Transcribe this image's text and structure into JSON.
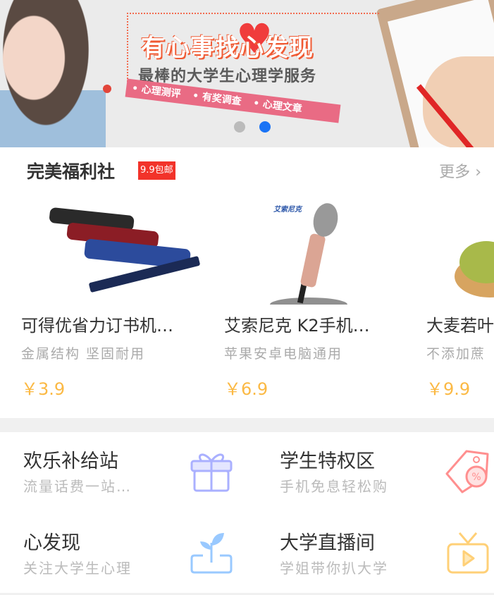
{
  "banner": {
    "headline": "有心事找心发现",
    "subtitle": "最棒的大学生心理学服务",
    "tags": [
      "• 心理测评",
      "• 有奖调查",
      "• 心理文章"
    ],
    "slides_total": 2,
    "active_slide": 2,
    "dot_colors": {
      "inactive": "#bbbbbb",
      "active": "#1a73f5"
    }
  },
  "welfare": {
    "title": "完美福利社",
    "badge": "9.9包邮",
    "more": "更多",
    "products": [
      {
        "title": "可得优省力订书机…",
        "subtitle": "金属结构 坚固耐用",
        "price": "￥3.9"
      },
      {
        "title": "艾索尼克 K2手机…",
        "subtitle": "苹果安卓电脑通用",
        "price": "￥6.9",
        "image_logo": "艾索尼克"
      },
      {
        "title": "大麦若叶",
        "subtitle": "不添加蔗",
        "price": "￥9.9"
      }
    ]
  },
  "tiles": [
    {
      "name": "欢乐补给站",
      "desc": "流量话费一站…",
      "icon": "gift-icon",
      "color": "#aab0ff"
    },
    {
      "name": "学生特权区",
      "desc": "手机免息轻松购",
      "icon": "discount-tag-icon",
      "color": "#ff8f8f"
    },
    {
      "name": "心发现",
      "desc": "关注大学生心理",
      "icon": "sprout-icon",
      "color": "#99c9ff"
    },
    {
      "name": "大学直播间",
      "desc": "学姐带你扒大学",
      "icon": "tv-play-icon",
      "color": "#ffd077"
    }
  ]
}
